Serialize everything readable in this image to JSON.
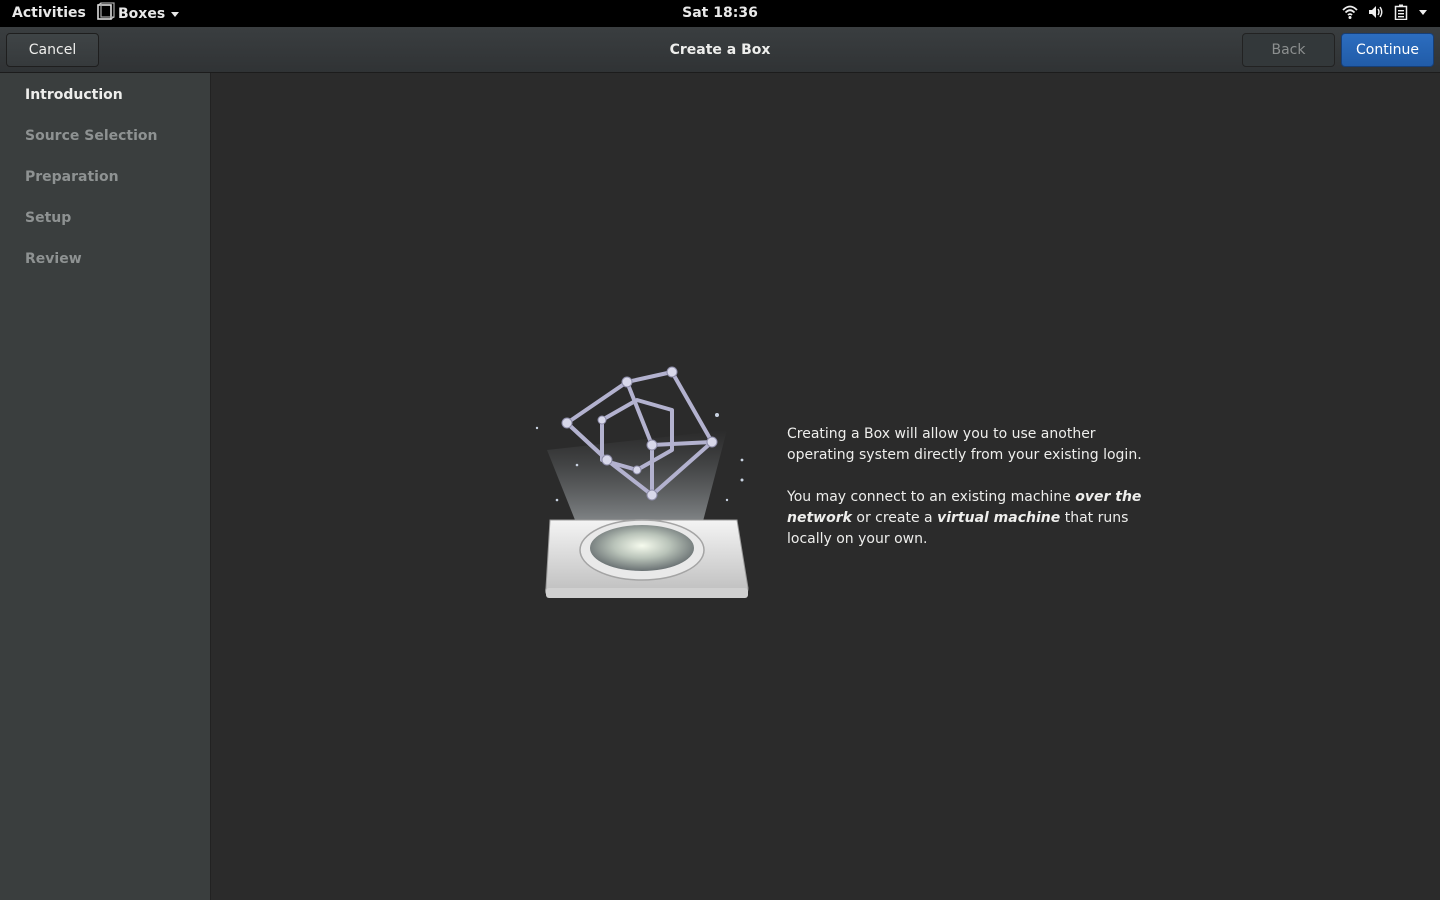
{
  "topbar": {
    "activities": "Activities",
    "app_name": "Boxes",
    "clock": "Sat 18:36",
    "icons": [
      "wifi-icon",
      "volume-icon",
      "battery-icon",
      "chevron-down-icon"
    ]
  },
  "header": {
    "title": "Create a Box",
    "cancel_label": "Cancel",
    "back_label": "Back",
    "continue_label": "Continue"
  },
  "sidebar": {
    "steps": [
      {
        "label": "Introduction",
        "active": true
      },
      {
        "label": "Source Selection",
        "active": false
      },
      {
        "label": "Preparation",
        "active": false
      },
      {
        "label": "Setup",
        "active": false
      },
      {
        "label": "Review",
        "active": false
      }
    ]
  },
  "main": {
    "para1": "Creating a Box will allow you to use another operating system directly from your existing login.",
    "para2": {
      "t1": "You may connect to an existing machine ",
      "b1": "over the network",
      "t2": " or create a ",
      "b2": "virtual machine",
      "t3": " that runs locally on your own."
    }
  },
  "colors": {
    "accent": "#215ca8",
    "sidebar_bg": "#3a3e3e",
    "main_bg": "#2b2b2b"
  }
}
